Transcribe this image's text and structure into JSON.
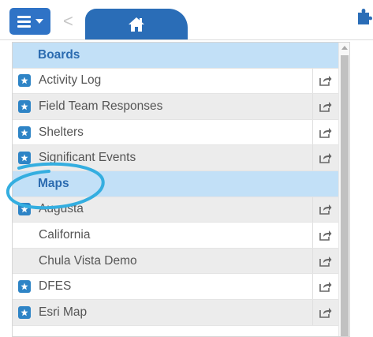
{
  "toolbar": {
    "menu_icon": "hamburger-menu-icon",
    "back_icon": "chevron-left-icon",
    "back_glyph": "<",
    "home_icon": "home-icon",
    "extension_icon": "puzzle-piece-icon",
    "accent_color": "#2f73c6"
  },
  "menu": {
    "rows": [
      {
        "type": "header",
        "label": "Boards"
      },
      {
        "type": "item",
        "label": "Activity Log",
        "favorite": true
      },
      {
        "type": "item",
        "label": "Field Team Responses",
        "favorite": true
      },
      {
        "type": "item",
        "label": "Shelters",
        "favorite": true
      },
      {
        "type": "item",
        "label": "Significant Events",
        "favorite": true
      },
      {
        "type": "header",
        "label": "Maps"
      },
      {
        "type": "item",
        "label": "Augusta",
        "favorite": true
      },
      {
        "type": "item",
        "label": "California",
        "favorite": false
      },
      {
        "type": "item",
        "label": "Chula Vista Demo",
        "favorite": false
      },
      {
        "type": "item",
        "label": "DFES",
        "favorite": true
      },
      {
        "type": "item",
        "label": "Esri Map",
        "favorite": true
      }
    ],
    "header_color": "#c2e0f7",
    "header_text_color": "#2b6bb0",
    "star_color": "#2e84c6",
    "share_icon": "share-icon",
    "star_icon": "star-icon"
  },
  "annotation": {
    "color": "#34aee0",
    "shape": "circle around Maps header"
  }
}
